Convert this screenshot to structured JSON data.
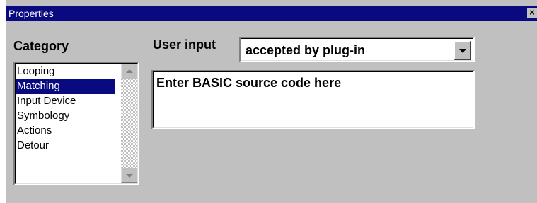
{
  "window": {
    "title": "Properties",
    "close_glyph": "×"
  },
  "category": {
    "label": "Category",
    "items": [
      {
        "label": "Looping",
        "selected": false
      },
      {
        "label": "Matching",
        "selected": true
      },
      {
        "label": "Input Device",
        "selected": false
      },
      {
        "label": "Symbology",
        "selected": false
      },
      {
        "label": "Actions",
        "selected": false
      },
      {
        "label": "Detour",
        "selected": false
      }
    ]
  },
  "user_input": {
    "label": "User input",
    "selected_value": "accepted by plug-in"
  },
  "code": {
    "placeholder": "Enter BASIC source code here"
  },
  "icons": {
    "close": "close-icon",
    "scroll_up": "arrow-up-icon",
    "scroll_down": "arrow-down-icon",
    "dropdown": "chevron-down-icon"
  },
  "colors": {
    "titlebar": "#0a0a80",
    "face": "#c0c0c0",
    "selection": "#0a0a80"
  }
}
